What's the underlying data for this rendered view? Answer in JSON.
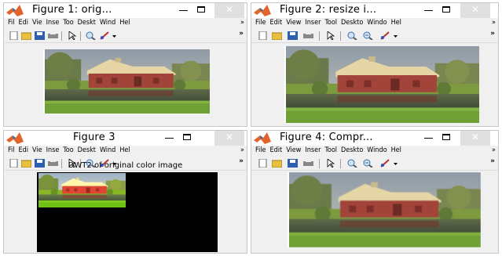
{
  "windows": [
    {
      "title": "Figure 1: orig...",
      "menu": [
        "Fil",
        "Edi",
        "Vie",
        "Inse",
        "Too",
        "Deskt",
        "Wind",
        "Hel"
      ],
      "menu_more": "»",
      "toolbar_more": "»"
    },
    {
      "title": "Figure 2: resize i...",
      "menu": [
        "File",
        "Edit",
        "View",
        "Inser",
        "Tool",
        "Deskto",
        "Windo",
        "Hel"
      ],
      "menu_more": "»",
      "toolbar_more": "»"
    },
    {
      "title": "Figure 3",
      "menu": [
        "Fil",
        "Edi",
        "Vie",
        "Inse",
        "Too",
        "Deskt",
        "Wind",
        "Hel"
      ],
      "menu_more": "»",
      "toolbar_more": "»",
      "axes_title": "DWT2 of original color image"
    },
    {
      "title": "Figure 4: Compr...",
      "menu": [
        "File",
        "Edit",
        "View",
        "Inser",
        "Tool",
        "Deskto",
        "Windo",
        "Hel"
      ],
      "menu_more": "»",
      "toolbar_more": "»"
    }
  ],
  "window_controls": {
    "minimize": "—",
    "maximize": "□",
    "close": "✕"
  },
  "icons": [
    "matlab-logo-icon",
    "new-figure-icon",
    "open-file-icon",
    "save-icon",
    "print-icon",
    "select-arrow-icon",
    "zoom-in-icon",
    "zoom-out-icon",
    "brush-icon",
    "chevron-down-icon"
  ],
  "colors": {
    "title_bar": "#ffffff",
    "figure_bg": "#f0f0f0",
    "close_button": "#e0e0e0",
    "barn_red": "#a84a3a",
    "roof": "#e8d8a8",
    "grass": "#6f9a3a"
  }
}
